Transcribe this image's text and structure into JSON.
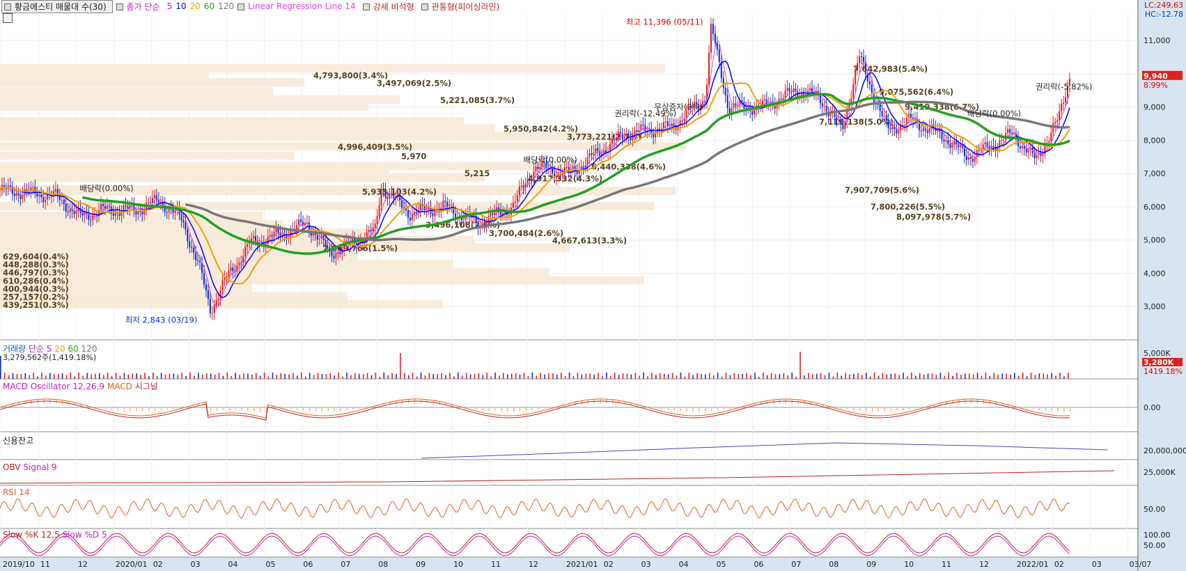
{
  "legend": {
    "stock": "황금에스티 매물대 수(30)",
    "price": "종가 단순",
    "ma5": "5",
    "ma10": "10",
    "ma20": "20",
    "ma60": "60",
    "ma120": "120",
    "lrl": "Linear Regression Line 14",
    "strong": "강세 비석형",
    "through": "관통형(피어싱라인)"
  },
  "lc": "LC:249.63",
  "hc": "HC:-12.78",
  "colors": {
    "ma5": "#0000ff",
    "ma10": "#0000ff",
    "ma20": "#f0a000",
    "ma60": "#20a020",
    "ma120": "#777777",
    "up": "#e02020",
    "down": "#1030d0",
    "lrl": "#e040e0"
  },
  "chart_data": {
    "type": "candlestick",
    "x_ticks": [
      "2019/10",
      "11",
      "12",
      "2020/01",
      "02",
      "03",
      "04",
      "05",
      "06",
      "07",
      "08",
      "09",
      "10",
      "11",
      "12",
      "2021/01",
      "02",
      "03",
      "04",
      "05",
      "06",
      "07",
      "08",
      "09",
      "10",
      "11",
      "12",
      "2022/01",
      "02",
      "03",
      "03/07"
    ],
    "y_ticks": [
      3000,
      4000,
      5000,
      6000,
      7000,
      8000,
      9000,
      10000,
      11000
    ],
    "y_tick_labels": [
      "3,000",
      "4,000",
      "5,000",
      "6,000",
      "7,000",
      "8,000",
      "9,000",
      "10,000",
      "11,000"
    ],
    "ylim": [
      2000,
      11800
    ],
    "close_path": [
      [
        0,
        6500
      ],
      [
        0.03,
        6400
      ],
      [
        0.05,
        6300
      ],
      [
        0.07,
        5700
      ],
      [
        0.09,
        5900
      ],
      [
        0.12,
        5900
      ],
      [
        0.14,
        6200
      ],
      [
        0.16,
        5600
      ],
      [
        0.175,
        4200
      ],
      [
        0.185,
        2900
      ],
      [
        0.2,
        3900
      ],
      [
        0.22,
        4900
      ],
      [
        0.25,
        5200
      ],
      [
        0.27,
        5500
      ],
      [
        0.29,
        4600
      ],
      [
        0.31,
        4900
      ],
      [
        0.33,
        5300
      ],
      [
        0.335,
        6600
      ],
      [
        0.36,
        5800
      ],
      [
        0.39,
        6000
      ],
      [
        0.42,
        5500
      ],
      [
        0.45,
        6000
      ],
      [
        0.47,
        7200
      ],
      [
        0.5,
        7000
      ],
      [
        0.52,
        7500
      ],
      [
        0.55,
        8200
      ],
      [
        0.59,
        8400
      ],
      [
        0.62,
        9300
      ],
      [
        0.625,
        11400
      ],
      [
        0.64,
        9000
      ],
      [
        0.67,
        9000
      ],
      [
        0.7,
        9500
      ],
      [
        0.72,
        9300
      ],
      [
        0.74,
        8300
      ],
      [
        0.755,
        10500
      ],
      [
        0.78,
        8300
      ],
      [
        0.8,
        8600
      ],
      [
        0.83,
        8100
      ],
      [
        0.85,
        7500
      ],
      [
        0.87,
        7800
      ],
      [
        0.89,
        8200
      ],
      [
        0.91,
        7400
      ],
      [
        0.93,
        8600
      ],
      [
        0.94,
        9940
      ]
    ],
    "price_labels": [
      {
        "text": "4,793,800(3.4%)",
        "y": 9950
      },
      {
        "text": "3,497,069(2.5%)",
        "y": 9720
      },
      {
        "text": "5,221,085(3.7%)",
        "y": 9200
      },
      {
        "text": "5,950,842(4.2%)",
        "y": 8350
      },
      {
        "text": "3,773,221(2.7%)",
        "y": 8100
      },
      {
        "text": "4,996,409(3.5%)",
        "y": 7800
      },
      {
        "text": "5,970",
        "y": 7520
      },
      {
        "text": "5,215",
        "y": 7000
      },
      {
        "text": "4,917,332(4.3%)",
        "y": 6850
      },
      {
        "text": "6,440,338(4.6%)",
        "y": 7200
      },
      {
        "text": "5,933,103(4.2%)",
        "y": 6450
      },
      {
        "text": "3,496,108(2.5%)",
        "y": 5450
      },
      {
        "text": "3,700,484(2.6%)",
        "y": 5200
      },
      {
        "text": "4,667,613(3.3%)",
        "y": 4980
      },
      {
        "text": "2,069,766(1.5%)",
        "y": 4750
      },
      {
        "text": "7,642,983(5.4%)",
        "y": 10150
      },
      {
        "text": "9,075,562(6.4%)",
        "y": 9450
      },
      {
        "text": "9,419,338(6.7%)",
        "y": 9000
      },
      {
        "text": "7,119,138(5.0%)",
        "y": 8550
      },
      {
        "text": "7,907,709(5.6%)",
        "y": 6500
      },
      {
        "text": "7,800,226(5.5%)",
        "y": 6000
      },
      {
        "text": "8,097,978(5.7%)",
        "y": 5700
      },
      {
        "text": "629,604(0.4%)",
        "y": 4500
      },
      {
        "text": "448,288(0.3%)",
        "y": 4260
      },
      {
        "text": "446,797(0.3%)",
        "y": 4020
      },
      {
        "text": "610,286(0.4%)",
        "y": 3770
      },
      {
        "text": "400,944(0.3%)",
        "y": 3530
      },
      {
        "text": "257,157(0.2%)",
        "y": 3290
      },
      {
        "text": "439,251(0.3%)",
        "y": 3050
      }
    ],
    "annotations": [
      {
        "text": "배당락(0.00%)",
        "y": 6350
      },
      {
        "text": "권리락(-12.49%)",
        "y": 8600
      },
      {
        "text": "무상증자(0%)",
        "y": 8800
      },
      {
        "text": "배당락(0.00%)",
        "y": 7200
      },
      {
        "text": "배당락(0.00%)",
        "y": 8600
      },
      {
        "text": "권리락(-5.82%)",
        "y": 9400
      },
      {
        "text": "최고 11,396 (05/11)",
        "y": 11396
      },
      {
        "text": "최저 2,843 (03/19)",
        "y": 2843
      }
    ],
    "last_price": "9,940",
    "last_pct": "8.99%"
  },
  "volume": {
    "title": "거래량",
    "ma": "단순",
    "p5": "5",
    "p20": "20",
    "p60": "60",
    "p120": "120",
    "value": "3,279,562주(1,419.18%)",
    "tick": "5,000K",
    "last": "3,280K",
    "last_pct": "1419.18%"
  },
  "macd": {
    "title": "MACD Oscillator 12,26,9",
    "m": "MACD",
    "s": "시그널",
    "tick": "0.00"
  },
  "credit": {
    "title": "신용잔고",
    "tick": "20,000,000"
  },
  "obv": {
    "title": "OBV",
    "s": "Signal 9",
    "tick": "25,000K"
  },
  "rsi": {
    "title": "RSI 14",
    "tick": "50.00"
  },
  "slow": {
    "title": "Slow %K 12,5",
    "d": "Slow %D 5",
    "t100": "100.00",
    "t50": "50.00"
  }
}
